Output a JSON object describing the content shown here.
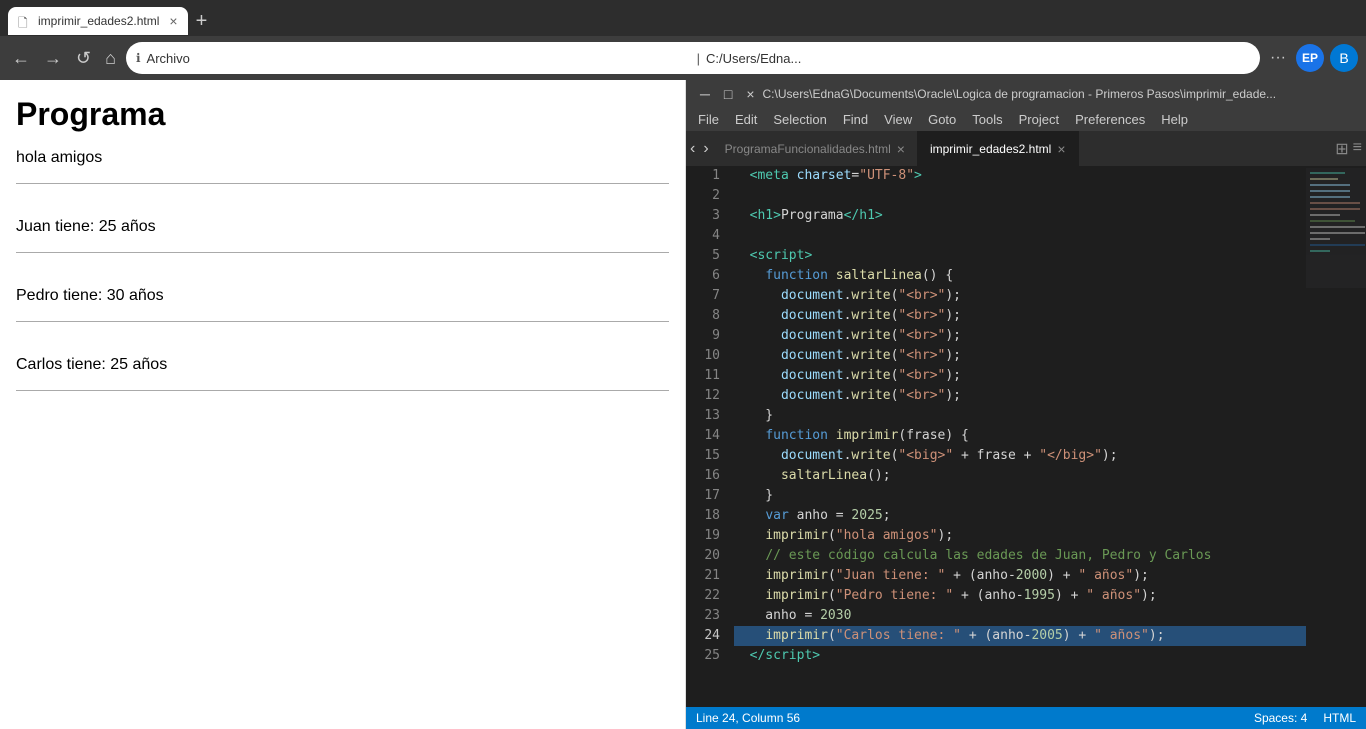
{
  "browser": {
    "tab_title": "imprimir_edades2.html",
    "tab_close": "×",
    "tab_new": "+",
    "nav": {
      "back_label": "←",
      "forward_label": "→",
      "home_label": "⌂",
      "address_icon": "ℹ",
      "address_label": "Archivo",
      "address_path": "C:/Users/Edna...",
      "refresh_label": "↺",
      "more_label": "···"
    },
    "profile_initials": "EP",
    "bing_label": "B"
  },
  "page": {
    "heading": "Programa",
    "line1": "hola amigos",
    "line2": "Juan tiene: 25 años",
    "line3": "Pedro tiene: 30 años",
    "line4": "Carlos tiene: 25 años"
  },
  "vscode": {
    "titlebar": "C:\\Users\\EdnaG\\Documents\\Oracle\\Logica de programacion - Primeros Pasos\\imprimir_edade...",
    "menu_items": [
      "File",
      "Edit",
      "Selection",
      "Find",
      "View",
      "Goto",
      "Tools",
      "Project",
      "Preferences",
      "Help"
    ],
    "tabs": [
      {
        "label": "ProgramaFuncionalidades.html",
        "active": false
      },
      {
        "label": "imprimir_edades2.html",
        "active": true
      }
    ],
    "status": {
      "line_col": "Line 24, Column 56",
      "spaces": "Spaces: 4",
      "language": "HTML"
    },
    "lines": [
      {
        "num": 1,
        "code": "  <span class='tag'>&lt;meta</span> <span class='attr'>charset</span><span class='op'>=</span><span class='val'>\"UTF-8\"</span><span class='tag'>&gt;</span>"
      },
      {
        "num": 2,
        "code": ""
      },
      {
        "num": 3,
        "code": "  <span class='tag'>&lt;h1&gt;</span><span>Programa</span><span class='tag'>&lt;/h1&gt;</span>"
      },
      {
        "num": 4,
        "code": ""
      },
      {
        "num": 5,
        "code": "  <span class='tag'>&lt;script&gt;</span>"
      },
      {
        "num": 6,
        "code": "    <span class='kw'>function</span> <span class='fn'>saltarLinea</span><span class='punct'>() {</span>"
      },
      {
        "num": 7,
        "code": "      <span class='obj'>document</span><span class='punct'>.</span><span class='mth'>write</span><span class='punct'>(</span><span class='str'>\"&lt;br&gt;\"</span><span class='punct'>);</span>"
      },
      {
        "num": 8,
        "code": "      <span class='obj'>document</span><span class='punct'>.</span><span class='mth'>write</span><span class='punct'>(</span><span class='str'>\"&lt;br&gt;\"</span><span class='punct'>);</span>"
      },
      {
        "num": 9,
        "code": "      <span class='obj'>document</span><span class='punct'>.</span><span class='mth'>write</span><span class='punct'>(</span><span class='str'>\"&lt;br&gt;\"</span><span class='punct'>);</span>"
      },
      {
        "num": 10,
        "code": "      <span class='obj'>document</span><span class='punct'>.</span><span class='mth'>write</span><span class='punct'>(</span><span class='str'>\"&lt;hr&gt;\"</span><span class='punct'>);</span>"
      },
      {
        "num": 11,
        "code": "      <span class='obj'>document</span><span class='punct'>.</span><span class='mth'>write</span><span class='punct'>(</span><span class='str'>\"&lt;br&gt;\"</span><span class='punct'>);</span>"
      },
      {
        "num": 12,
        "code": "      <span class='obj'>document</span><span class='punct'>.</span><span class='mth'>write</span><span class='punct'>(</span><span class='str'>\"&lt;br&gt;\"</span><span class='punct'>);</span>"
      },
      {
        "num": 13,
        "code": "    <span class='punct'>}</span>"
      },
      {
        "num": 14,
        "code": "    <span class='kw'>function</span> <span class='fn'>imprimir</span><span class='punct'>(</span><span class='obj'>frase</span><span class='punct'>) {</span>"
      },
      {
        "num": 15,
        "code": "      <span class='obj'>document</span><span class='punct'>.</span><span class='mth'>write</span><span class='punct'>(</span><span class='str'>\"&lt;big&gt;\"</span> <span class='op'>+</span> <span class='obj'>frase</span> <span class='op'>+</span> <span class='str'>\"&lt;/big&gt;\"</span><span class='punct'>);</span>"
      },
      {
        "num": 16,
        "code": "      <span class='fn'>saltarLinea</span><span class='punct'>();</span>"
      },
      {
        "num": 17,
        "code": "    <span class='punct'>}</span>"
      },
      {
        "num": 18,
        "code": "    <span class='kw'>var</span> <span class='obj'>anho</span> <span class='op'>=</span> <span class='num'>2025</span><span class='punct'>;</span>"
      },
      {
        "num": 19,
        "code": "    <span class='fn'>imprimir</span><span class='punct'>(</span><span class='str'>\"hola amigos\"</span><span class='punct'>);</span>"
      },
      {
        "num": 20,
        "code": "    <span class='comment'>// este código calcula las edades de Juan, Pedro y Carlos</span>"
      },
      {
        "num": 21,
        "code": "    <span class='fn'>imprimir</span><span class='punct'>(</span><span class='str'>\"Juan tiene: \"</span> <span class='op'>+</span> <span class='punct'>(</span><span class='obj'>anho</span><span class='op'>-</span><span class='num'>2000</span><span class='punct'>)</span> <span class='op'>+</span> <span class='str'>\" años\"</span><span class='punct'>);</span>"
      },
      {
        "num": 22,
        "code": "    <span class='fn'>imprimir</span><span class='punct'>(</span><span class='str'>\"Pedro tiene: \"</span> <span class='op'>+</span> <span class='punct'>(</span><span class='obj'>anho</span><span class='op'>-</span><span class='num'>1995</span><span class='punct'>)</span> <span class='op'>+</span> <span class='str'>\" años\"</span><span class='punct'>);</span>"
      },
      {
        "num": 23,
        "code": "    <span class='obj'>anho</span> <span class='op'>=</span> <span class='num'>2030</span>"
      },
      {
        "num": 24,
        "code": "    <span class='fn'>imprimir</span><span class='punct'>(</span><span class='str'>\"Carlos tiene: \"</span> <span class='op'>+</span> <span class='punct'>(</span><span class='obj'>anho</span><span class='op'>-</span><span class='num'>2005</span><span class='punct'>)</span> <span class='op'>+</span> <span class='str'>\" años\"</span><span class='punct'>);</span>",
        "highlighted": true
      },
      {
        "num": 25,
        "code": "  <span class='tag'>&lt;/script&gt;</span>"
      }
    ]
  }
}
